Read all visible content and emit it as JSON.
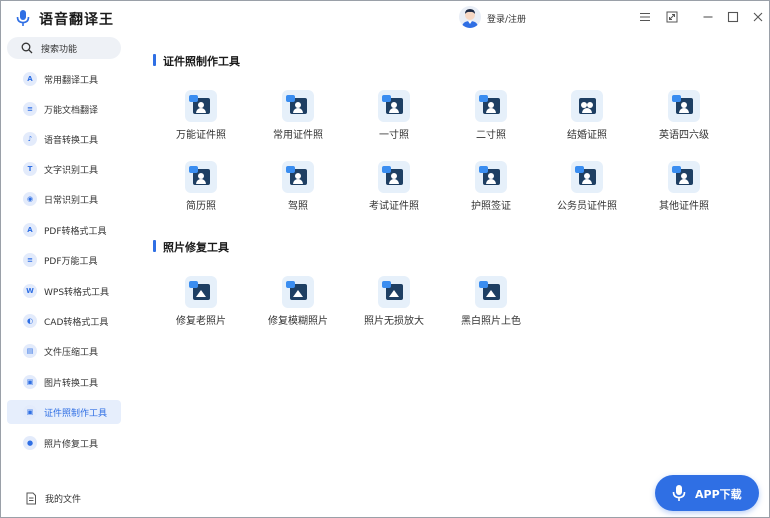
{
  "app": {
    "title": "语音翻译王"
  },
  "header": {
    "login_label": "登录/注册"
  },
  "sidebar": {
    "search_label": "搜索功能",
    "items": [
      {
        "label": "常用翻译工具",
        "icon": "translate-icon",
        "glyph": "A"
      },
      {
        "label": "万能文档翻译",
        "icon": "document-translate-icon",
        "glyph": "≡"
      },
      {
        "label": "语音转换工具",
        "icon": "voice-convert-icon",
        "glyph": "♪"
      },
      {
        "label": "文字识别工具",
        "icon": "text-recognition-icon",
        "glyph": "T"
      },
      {
        "label": "日常识别工具",
        "icon": "daily-recognition-icon",
        "glyph": "◉"
      },
      {
        "label": "PDF转格式工具",
        "icon": "pdf-convert-icon",
        "glyph": "A"
      },
      {
        "label": "PDF万能工具",
        "icon": "pdf-tools-icon",
        "glyph": "≡"
      },
      {
        "label": "WPS转格式工具",
        "icon": "wps-convert-icon",
        "glyph": "W"
      },
      {
        "label": "CAD转格式工具",
        "icon": "cad-convert-icon",
        "glyph": "◐"
      },
      {
        "label": "文件压缩工具",
        "icon": "file-compress-icon",
        "glyph": "▤"
      },
      {
        "label": "图片转换工具",
        "icon": "image-convert-icon",
        "glyph": "▣"
      },
      {
        "label": "证件照制作工具",
        "icon": "id-photo-icon",
        "glyph": "▣"
      },
      {
        "label": "照片修复工具",
        "icon": "photo-repair-icon",
        "glyph": "●"
      }
    ],
    "active_item": "证件照制作工具",
    "my_files_label": "我的文件"
  },
  "sections": [
    {
      "title": "证件照制作工具",
      "tools": [
        {
          "label": "万能证件照",
          "icon": "id-photo-icon"
        },
        {
          "label": "常用证件照",
          "icon": "id-photo-icon"
        },
        {
          "label": "一寸照",
          "icon": "id-photo-icon"
        },
        {
          "label": "二寸照",
          "icon": "id-photo-icon"
        },
        {
          "label": "结婚证照",
          "icon": "couple-photo-icon"
        },
        {
          "label": "英语四六级",
          "icon": "id-photo-icon"
        },
        {
          "label": "简历照",
          "icon": "id-photo-icon"
        },
        {
          "label": "驾照",
          "icon": "id-photo-icon"
        },
        {
          "label": "考试证件照",
          "icon": "id-photo-icon"
        },
        {
          "label": "护照签证",
          "icon": "id-photo-icon"
        },
        {
          "label": "公务员证件照",
          "icon": "id-photo-icon"
        },
        {
          "label": "其他证件照",
          "icon": "id-photo-icon"
        }
      ]
    },
    {
      "title": "照片修复工具",
      "tools": [
        {
          "label": "修复老照片",
          "icon": "photo-repair-icon"
        },
        {
          "label": "修复模糊照片",
          "icon": "photo-repair-icon"
        },
        {
          "label": "照片无损放大",
          "icon": "photo-enlarge-icon"
        },
        {
          "label": "黑白照片上色",
          "icon": "photo-colorize-icon"
        }
      ]
    }
  ],
  "app_download": {
    "label": "APP下载"
  },
  "colors": {
    "accent": "#2f6fe4",
    "tile_bg": "#e6f0fa",
    "card": "#1e3f63",
    "badge": "#3a8df0"
  }
}
